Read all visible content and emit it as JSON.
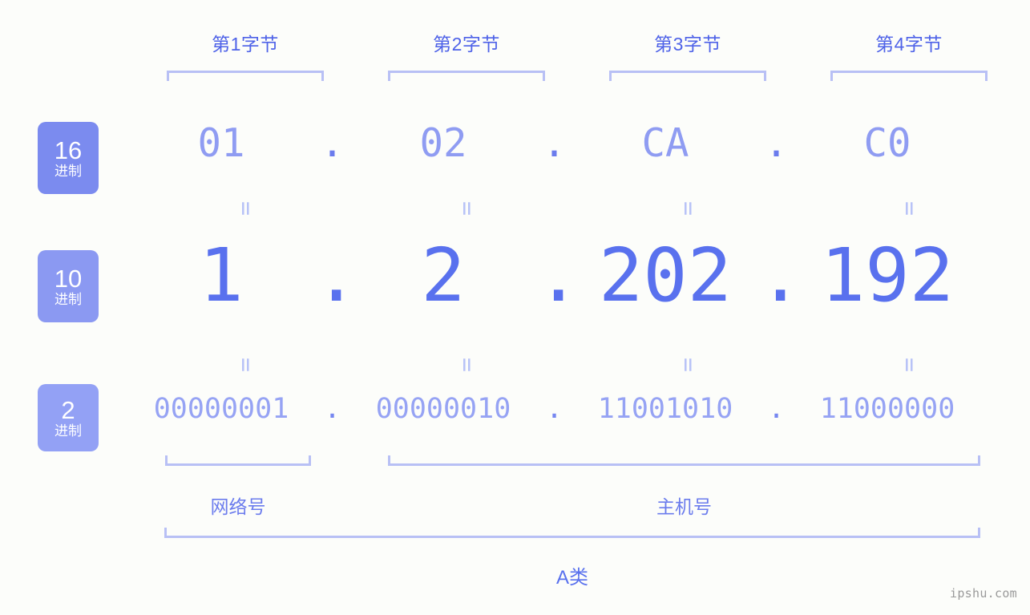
{
  "watermark": "ipshu.com",
  "byte_headers": [
    {
      "label": "第1字节"
    },
    {
      "label": "第2字节"
    },
    {
      "label": "第3字节"
    },
    {
      "label": "第4字节"
    }
  ],
  "rows": {
    "hex": {
      "badge_number": "16",
      "badge_sub": "进制",
      "badge_color": "#7b8bef",
      "values": [
        "01",
        "02",
        "CA",
        "C0"
      ],
      "separator": "."
    },
    "dec": {
      "badge_number": "10",
      "badge_sub": "进制",
      "badge_color": "#8b99f2",
      "values": [
        "1",
        "2",
        "202",
        "192"
      ],
      "separator": "."
    },
    "bin": {
      "badge_number": "2",
      "badge_sub": "进制",
      "badge_color": "#93a1f5",
      "values": [
        "00000001",
        "00000010",
        "11001010",
        "11000000"
      ],
      "separator": "."
    }
  },
  "equals_sign": "=",
  "segments": {
    "network_label": "网络号",
    "host_label": "主机号"
  },
  "class": {
    "label": "A类"
  },
  "colors": {
    "background": "#fcfdfa",
    "bracket": "#b8c0f5",
    "accent_strong": "#5971ee",
    "accent_mid": "#6b7ced",
    "accent_light": "#96a3f4"
  }
}
